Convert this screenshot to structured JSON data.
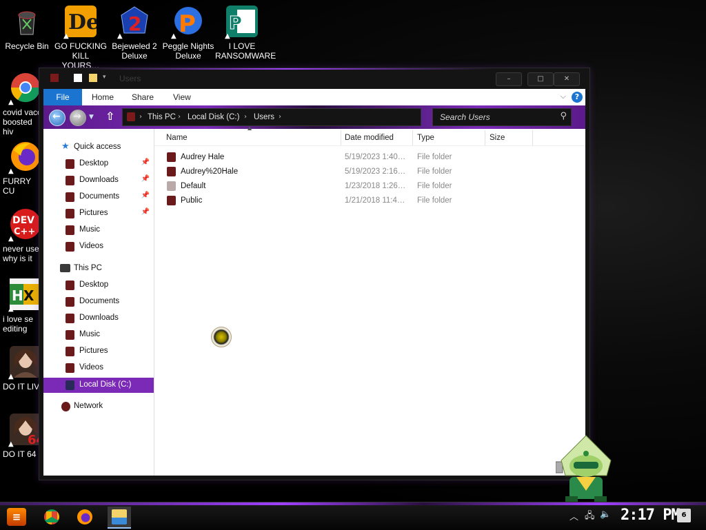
{
  "desktop": {
    "icons": [
      {
        "label": "Recycle Bin",
        "icon": "recycle-bin-icon"
      },
      {
        "label": "GO FUCKING\nKILL YOURS…",
        "icon": "directx-icon"
      },
      {
        "label": "Bejeweled 2\nDeluxe",
        "icon": "bejeweled-icon"
      },
      {
        "label": "Peggle Nights\nDeluxe",
        "icon": "peggle-icon"
      },
      {
        "label": "I LOVE\nRANSOMWARE",
        "icon": "publisher-icon"
      },
      {
        "label": "covid vacc\nboosted hiv",
        "icon": "chrome-icon"
      },
      {
        "label": "FURRY CU",
        "icon": "firefox-icon"
      },
      {
        "label": "never use\nwhy is it",
        "icon": "devcpp-icon"
      },
      {
        "label": "i love se\nediting",
        "icon": "hxd-icon"
      },
      {
        "label": "DO IT LIV",
        "icon": "portrait-icon"
      },
      {
        "label": "DO IT 64 I",
        "icon": "portrait-icon"
      }
    ]
  },
  "window": {
    "title": "Users",
    "ribbon": {
      "file": "File",
      "home": "Home",
      "share": "Share",
      "view": "View",
      "help": "?"
    },
    "breadcrumb": [
      "This PC",
      "Local Disk (C:)",
      "Users"
    ],
    "search_placeholder": "Search Users",
    "nav": {
      "quick_access": "Quick access",
      "quick_items": [
        "Desktop",
        "Downloads",
        "Documents",
        "Pictures",
        "Music",
        "Videos"
      ],
      "this_pc": "This PC",
      "pc_items": [
        "Desktop",
        "Documents",
        "Downloads",
        "Music",
        "Pictures",
        "Videos",
        "Local Disk (C:)"
      ],
      "network": "Network"
    },
    "columns": [
      "Name",
      "Date modified",
      "Type",
      "Size"
    ],
    "rows": [
      {
        "name": "Audrey Hale",
        "date": "5/19/2023 1:40…",
        "type": "File folder"
      },
      {
        "name": "Audrey%20Hale",
        "date": "5/19/2023 2:16…",
        "type": "File folder"
      },
      {
        "name": "Default",
        "date": "1/23/2018 1:26…",
        "type": "File folder"
      },
      {
        "name": "Public",
        "date": "1/21/2018 11:4…",
        "type": "File folder"
      }
    ]
  },
  "taskbar": {
    "start": "≡",
    "apps": [
      "chrome-icon",
      "firefox-icon",
      "file-explorer-icon"
    ],
    "clock": "2:17 PM",
    "notification_count": "6"
  },
  "colors": {
    "accent": "#7a2ab6",
    "file_tab": "#1b75d0"
  }
}
